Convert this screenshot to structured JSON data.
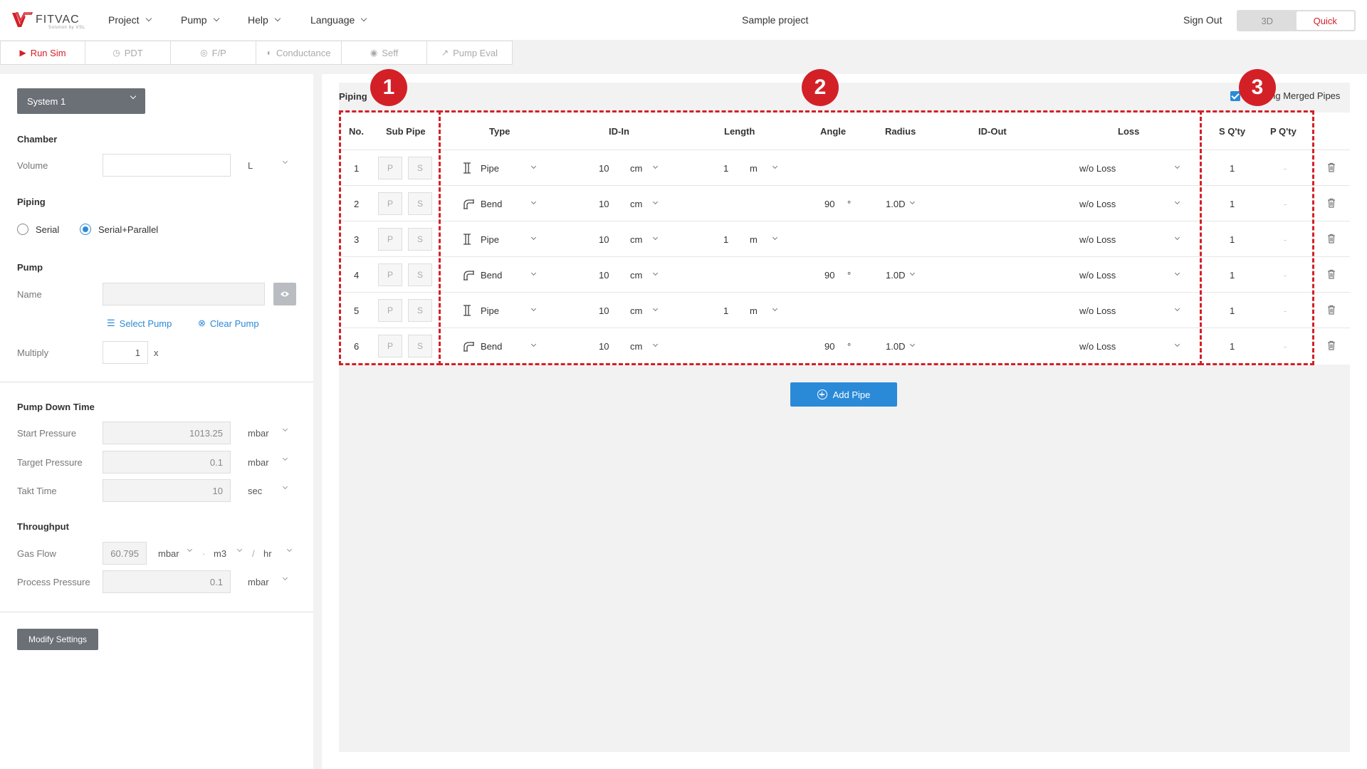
{
  "brand": {
    "name": "FITVAC",
    "tagline": "Solution by VSL"
  },
  "nav": {
    "items": [
      {
        "label": "Project"
      },
      {
        "label": "Pump"
      },
      {
        "label": "Help"
      },
      {
        "label": "Language"
      }
    ],
    "project_title": "Sample project",
    "sign_out": "Sign Out",
    "view_mode": {
      "options": [
        "3D",
        "Quick"
      ],
      "selected": "Quick"
    }
  },
  "toolbar": {
    "run_sim": "Run Sim",
    "pdt": "PDT",
    "fp": "F/P",
    "conductance": "Conductance",
    "seff": "Seff",
    "pump_eval": "Pump Eval"
  },
  "left": {
    "system_select": "System 1",
    "chamber": {
      "title": "Chamber",
      "volume_label": "Volume",
      "volume_value": "",
      "volume_unit": "L"
    },
    "piping": {
      "title": "Piping",
      "options": [
        "Serial",
        "Serial+Parallel"
      ],
      "selected": "Serial+Parallel"
    },
    "pump": {
      "title": "Pump",
      "name_label": "Name",
      "name_value": "",
      "select_pump": "Select Pump",
      "clear_pump": "Clear Pump",
      "multiply_label": "Multiply",
      "multiply_value": "1",
      "multiply_suffix": "x"
    },
    "pump_down": {
      "title": "Pump Down Time",
      "start_label": "Start Pressure",
      "start_value": "1013.25",
      "start_unit": "mbar",
      "target_label": "Target Pressure",
      "target_value": "0.1",
      "target_unit": "mbar",
      "takt_label": "Takt Time",
      "takt_value": "10",
      "takt_unit": "sec"
    },
    "throughput": {
      "title": "Throughput",
      "gas_label": "Gas Flow",
      "gas_value": "60.795",
      "gas_unit1": "mbar",
      "gas_sep": "·",
      "gas_unit2": "m3",
      "gas_slash": "/",
      "gas_unit3": "hr",
      "process_label": "Process Pressure",
      "process_value": "0.1",
      "process_unit": "mbar"
    },
    "modify_settings": "Modify Settings"
  },
  "piping_table": {
    "section_label": "Piping",
    "merged_label": "ding Merged Pipes",
    "headers": {
      "no": "No.",
      "sub_pipe": "Sub Pipe",
      "type": "Type",
      "id_in": "ID-In",
      "length": "Length",
      "angle": "Angle",
      "radius": "Radius",
      "id_out": "ID-Out",
      "loss": "Loss",
      "s_qty": "S Q'ty",
      "p_qty": "P Q'ty"
    },
    "p_label": "P",
    "s_label": "S",
    "rows": [
      {
        "no": "1",
        "type": "Pipe",
        "id_in": "10",
        "id_unit": "cm",
        "length": "1",
        "len_unit": "m",
        "angle": "",
        "deg": "",
        "radius": "",
        "loss": "w/o Loss",
        "s_qty": "1",
        "p_qty": "-"
      },
      {
        "no": "2",
        "type": "Bend",
        "id_in": "10",
        "id_unit": "cm",
        "length": "",
        "len_unit": "",
        "angle": "90",
        "deg": "°",
        "radius": "1.0D",
        "loss": "w/o Loss",
        "s_qty": "1",
        "p_qty": "-"
      },
      {
        "no": "3",
        "type": "Pipe",
        "id_in": "10",
        "id_unit": "cm",
        "length": "1",
        "len_unit": "m",
        "angle": "",
        "deg": "",
        "radius": "",
        "loss": "w/o Loss",
        "s_qty": "1",
        "p_qty": "-"
      },
      {
        "no": "4",
        "type": "Bend",
        "id_in": "10",
        "id_unit": "cm",
        "length": "",
        "len_unit": "",
        "angle": "90",
        "deg": "°",
        "radius": "1.0D",
        "loss": "w/o Loss",
        "s_qty": "1",
        "p_qty": "-"
      },
      {
        "no": "5",
        "type": "Pipe",
        "id_in": "10",
        "id_unit": "cm",
        "length": "1",
        "len_unit": "m",
        "angle": "",
        "deg": "",
        "radius": "",
        "loss": "w/o Loss",
        "s_qty": "1",
        "p_qty": "-"
      },
      {
        "no": "6",
        "type": "Bend",
        "id_in": "10",
        "id_unit": "cm",
        "length": "",
        "len_unit": "",
        "angle": "90",
        "deg": "°",
        "radius": "1.0D",
        "loss": "w/o Loss",
        "s_qty": "1",
        "p_qty": "-"
      }
    ],
    "add_pipe": "Add Pipe"
  },
  "annotations": {
    "badge1": "1",
    "badge2": "2",
    "badge3": "3"
  },
  "colors": {
    "accent": "#d32027",
    "primary": "#2b8ad8",
    "dark_button": "#6b7076"
  }
}
